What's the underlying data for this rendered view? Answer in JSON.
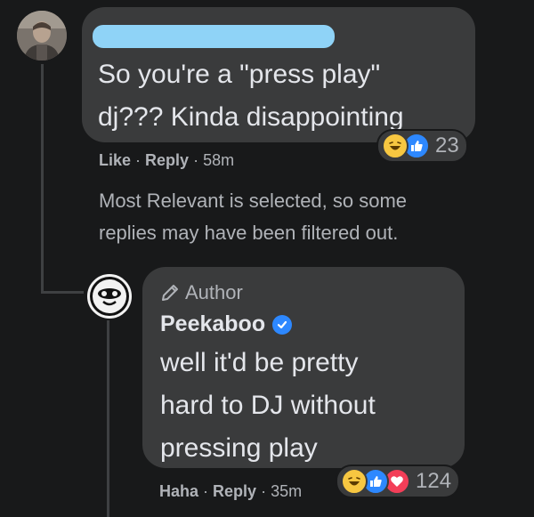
{
  "comment": {
    "text_lines": [
      "So you're a \"press play\"",
      "dj??? Kinda disappointing"
    ],
    "reactions": {
      "icons": [
        "haha-react-icon",
        "like-react-icon"
      ],
      "count": "23"
    },
    "actions": {
      "like_label": "Like",
      "separator": "·",
      "reply_label": "Reply",
      "time": "58m"
    }
  },
  "filter_notice": {
    "lines": [
      "Most Relevant is selected, so some",
      "replies may have been filtered out."
    ]
  },
  "reply": {
    "author_tag": "Author",
    "author_name": "Peekaboo",
    "text_lines": [
      "well it'd be pretty",
      "hard to DJ without",
      "pressing play"
    ],
    "reactions": {
      "icons": [
        "haha-react-icon",
        "like-react-icon",
        "love-react-icon"
      ],
      "count": "124"
    },
    "actions": {
      "haha_label": "Haha",
      "separator": "·",
      "reply_label": "Reply",
      "time": "35m"
    }
  },
  "colors": {
    "background": "#18191a",
    "bubble": "#3a3b3c",
    "text_primary": "#e4e6eb",
    "text_secondary": "#b0b3b8",
    "redaction": "#8fd3f7",
    "verified": "#2d88ff",
    "like_blue": "#2d88ff",
    "haha_yellow": "#f7c741",
    "love_red": "#f33e58"
  }
}
